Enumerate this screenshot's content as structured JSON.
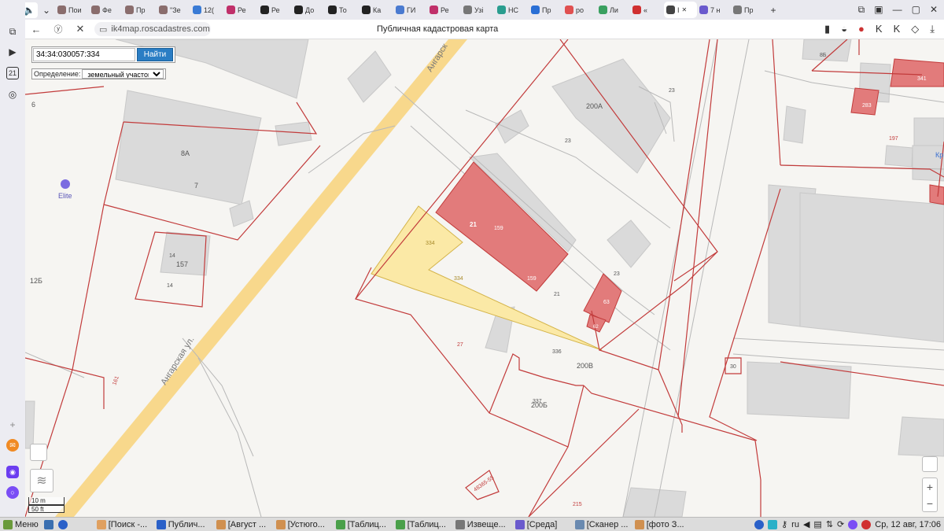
{
  "browser": {
    "tabs": [
      {
        "label": "Пои",
        "color": "#8a6d6d"
      },
      {
        "label": "Фе",
        "color": "#8a6d6d"
      },
      {
        "label": "Пр",
        "color": "#8a6d6d"
      },
      {
        "label": "\"Зе",
        "color": "#8a6d6d"
      },
      {
        "label": "12(",
        "color": "#3a7bd5"
      },
      {
        "label": "Ре",
        "color": "#c0306a"
      },
      {
        "label": "Ре",
        "color": "#222"
      },
      {
        "label": "До",
        "color": "#222"
      },
      {
        "label": "То",
        "color": "#222"
      },
      {
        "label": "Ка",
        "color": "#222"
      },
      {
        "label": "ГИ",
        "color": "#4a7ad0"
      },
      {
        "label": "Ре",
        "color": "#c0306a"
      },
      {
        "label": "Узі",
        "color": "#777"
      },
      {
        "label": "НС",
        "color": "#2a9d8f"
      },
      {
        "label": "Пр",
        "color": "#2a6fd5"
      },
      {
        "label": "ро",
        "color": "#e05050"
      },
      {
        "label": "Ли",
        "color": "#3aa060"
      },
      {
        "label": "«",
        "color": "#d03030"
      },
      {
        "label": "I",
        "color": "#444"
      },
      {
        "label": "7 н",
        "color": "#6a5acd"
      },
      {
        "label": "Пр",
        "color": "#777"
      }
    ],
    "url": "ik4map.roscadastres.com",
    "page_title": "Публичная кадастровая карта"
  },
  "search": {
    "value": "34:34:030057:334",
    "button_label": "Найти",
    "definition_label": "Определение:",
    "definition_value": "земельный участок"
  },
  "map": {
    "streets": {
      "road_top": "Ангарск",
      "road_bottom": "Ангарская ул."
    },
    "poi": "Elite",
    "labels": {
      "l6": "6",
      "l8a": "8А",
      "l7": "7",
      "l12b": "12Б",
      "l157": "157",
      "l14a": "14",
      "l14b": "14",
      "l200a": "200А",
      "l23a": "23",
      "l23b": "23",
      "l23c": "23",
      "l21a": "21",
      "l159a": "159",
      "l159b": "159",
      "l334a": "334",
      "l334b": "334",
      "l21b": "21",
      "l63": "63",
      "l27": "27",
      "l336": "336",
      "l200v": "200В",
      "l337": "337",
      "l200b": "200Б",
      "l30": "30",
      "l197": "197",
      "l8b": "8Б",
      "l341": "341",
      "l283": "283",
      "l161": "161",
      "l215": "215",
      "l48": "48365-55",
      "lkr": "Кр",
      "l62": "62"
    },
    "scale": {
      "meters": "10 m",
      "feet": "50 ft"
    },
    "colors": {
      "parcel": "#c23b3b",
      "building_fill": "#e27b7b",
      "selected_fill": "#fbe9a6",
      "road": "#f8d88c"
    }
  },
  "taskbar": {
    "menu": "Меню",
    "items": [
      "[Поиск -...",
      "Публич...",
      "[Август ...",
      "[Устюго...",
      "[Таблиц...",
      "[Таблиц...",
      "Извеще...",
      "[Среда]",
      "[Сканер ...",
      "[фото З..."
    ],
    "lang": "ru",
    "clock": "Ср, 12 авг, 17:06"
  }
}
